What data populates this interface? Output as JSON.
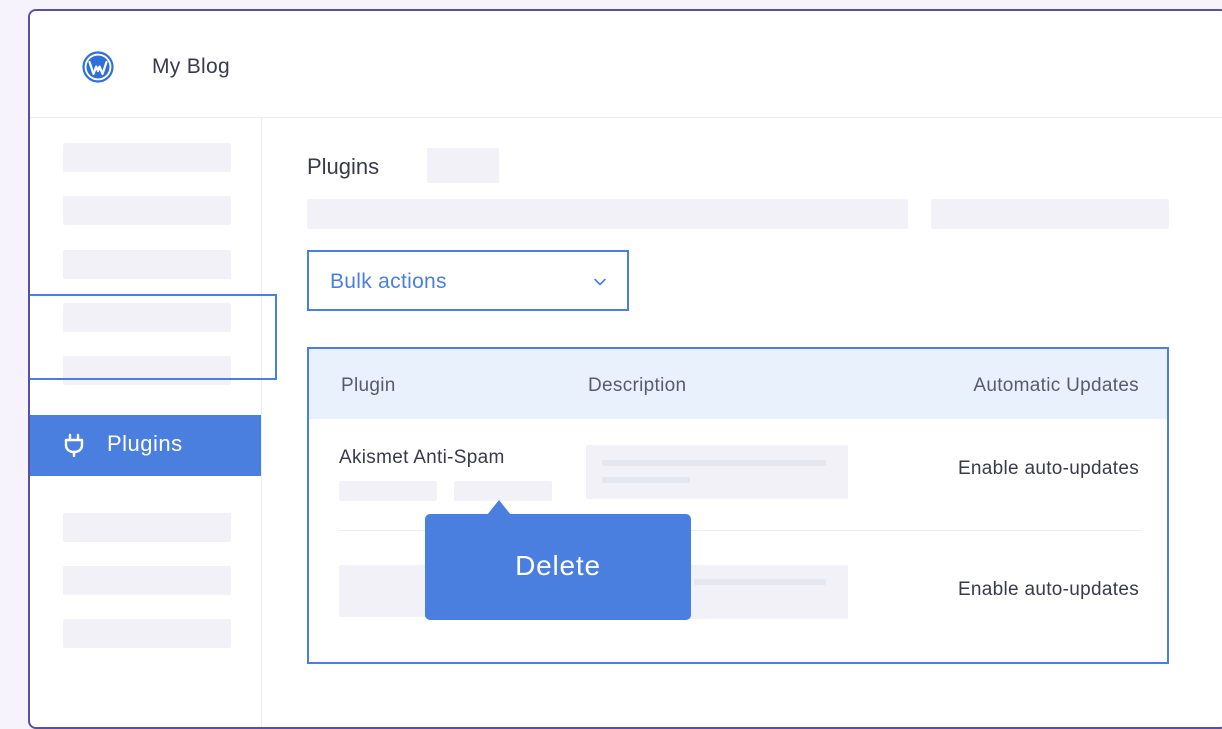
{
  "header": {
    "title": "My Blog",
    "logo_icon": "wordpress-logo-icon"
  },
  "sidebar": {
    "active_item": {
      "label": "Plugins",
      "icon": "plug-icon"
    }
  },
  "main": {
    "title": "Plugins",
    "bulk_actions": {
      "selected": "Bulk actions"
    },
    "table": {
      "columns": [
        "Plugin",
        "Description",
        "Automatic Updates"
      ],
      "rows": [
        {
          "name": "Akismet Anti-Spam",
          "auto_update": "Enable auto-updates"
        },
        {
          "name": "",
          "auto_update": "Enable auto-updates"
        }
      ]
    }
  },
  "tooltip": {
    "label": "Delete"
  },
  "colors": {
    "accent": "#4a7fe0",
    "frame": "#5b4fa3",
    "header_bg": "#e8f1fc"
  }
}
